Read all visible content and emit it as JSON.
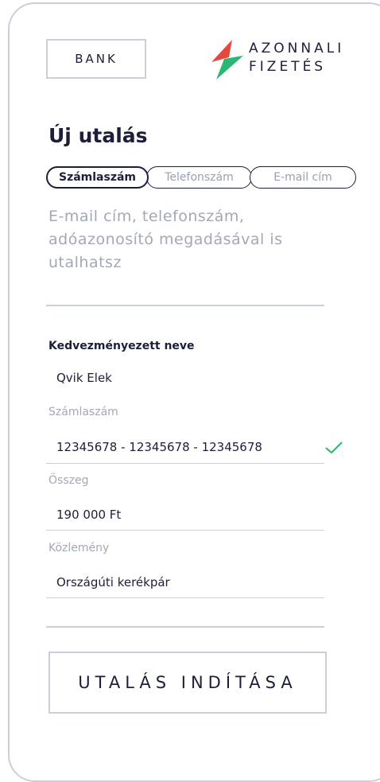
{
  "header": {
    "bank_label": "BANK",
    "logo_line1": "AZONNALI",
    "logo_line2": "FIZETÉS"
  },
  "page_title": "Új utalás",
  "tabs": [
    {
      "label": "Számlaszám",
      "active": true
    },
    {
      "label": "Telefonszám",
      "active": false
    },
    {
      "label": "E-mail cím",
      "active": false
    }
  ],
  "hint_text": "E-mail cím, telefonszám, adóazonosító megadásával is utalhatsz",
  "form": {
    "beneficiary_label": "Kedvezményezett neve",
    "beneficiary_value": "Qvik Elek",
    "account_label": "Számlaszám",
    "account_value": "12345678 - 12345678 - 12345678",
    "amount_label": "Összeg",
    "amount_value": "190 000 Ft",
    "note_label": "Közlemény",
    "note_value": "Országúti kerékpár"
  },
  "submit_label": "UTALÁS INDÍTÁSA",
  "colors": {
    "text": "#1d1f3a",
    "muted": "#a3a8b7",
    "border": "#c9cfdc",
    "check": "#2bb673",
    "logo_red": "#e8483b",
    "logo_green": "#2bb673"
  }
}
